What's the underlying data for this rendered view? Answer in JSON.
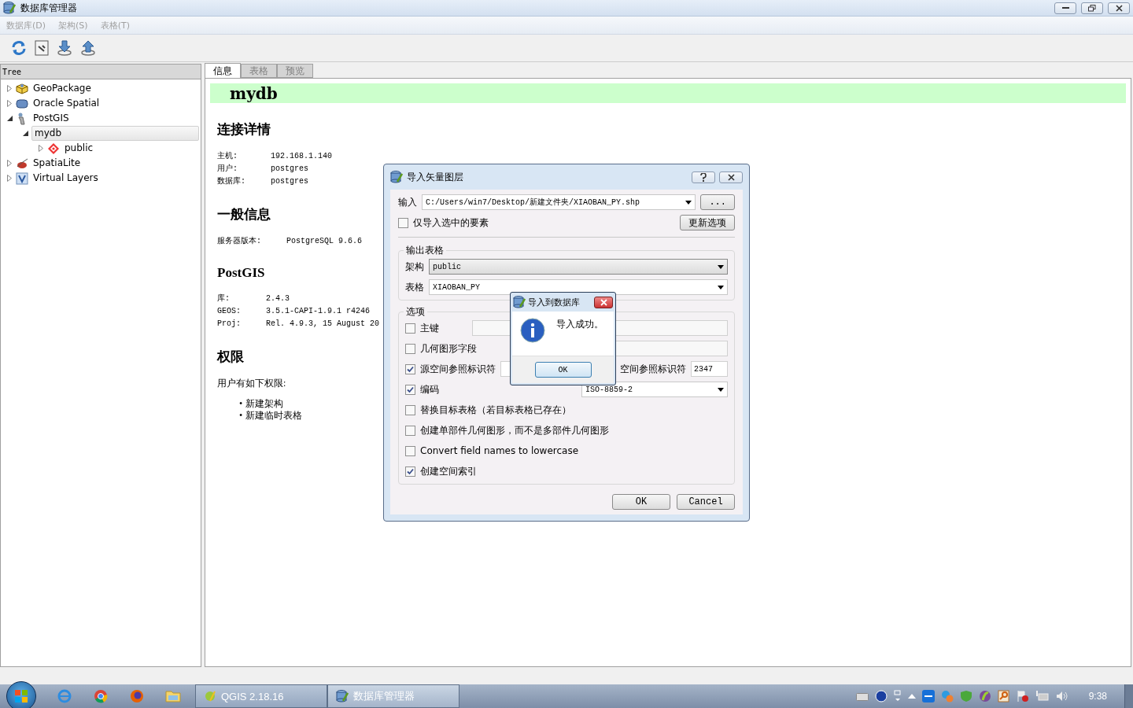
{
  "window": {
    "title": "数据库管理器"
  },
  "menu": [
    {
      "label": "数据库(D)",
      "disabled": true
    },
    {
      "label": "架构(S)",
      "disabled": true
    },
    {
      "label": "表格(T)",
      "disabled": true
    }
  ],
  "tree": {
    "header": "Tree",
    "items": [
      {
        "label": "GeoPackage",
        "kind": "geopackage",
        "expanded": false,
        "selected": false
      },
      {
        "label": "Oracle Spatial",
        "kind": "oracle",
        "expanded": false,
        "selected": false
      },
      {
        "label": "PostGIS",
        "kind": "postgis",
        "expanded": true,
        "selected": false,
        "children": [
          {
            "label": "mydb",
            "expanded": true,
            "selected": true,
            "children": [
              {
                "label": "public",
                "kind": "schema",
                "expanded": false,
                "selected": false
              }
            ]
          }
        ]
      },
      {
        "label": "SpatiaLite",
        "kind": "spatialite",
        "expanded": false,
        "selected": false
      },
      {
        "label": "Virtual Layers",
        "kind": "virtual",
        "expanded": false,
        "selected": false
      }
    ]
  },
  "tabs": [
    {
      "label": "信息",
      "selected": true
    },
    {
      "label": "表格",
      "selected": false
    },
    {
      "label": "预览",
      "selected": false
    }
  ],
  "info": {
    "title": "mydb",
    "sections": [
      {
        "kind": "table",
        "heading": "连接详情",
        "rows": [
          {
            "label": "主机:",
            "value": "192.168.1.140"
          },
          {
            "label": "用户:",
            "value": "postgres"
          },
          {
            "label": "数据库:",
            "value": "postgres"
          }
        ]
      },
      {
        "kind": "table",
        "heading": "一般信息",
        "rows": [
          {
            "label": "服务器版本:",
            "value": "PostgreSQL 9.6.6"
          }
        ]
      },
      {
        "kind": "table",
        "heading": "PostGIS",
        "rows": [
          {
            "label": "库:",
            "value": "2.4.3"
          },
          {
            "label": "GEOS:",
            "value": "3.5.1-CAPI-1.9.1 r4246"
          },
          {
            "label": "Proj:",
            "value": "Rel. 4.9.3, 15 August 20"
          }
        ]
      },
      {
        "kind": "list",
        "heading": "权限",
        "text": "用户有如下权限:",
        "bullet": "•",
        "items": [
          "新建架构",
          "新建临时表格"
        ]
      }
    ]
  },
  "import_dialog": {
    "title": "导入矢量图层",
    "input": {
      "label": "输入",
      "value": "C:/Users/win7/Desktop/新建文件夹/XIAOBAN_PY.shp",
      "browse": "..."
    },
    "only_selected": {
      "label": "仅导入选中的要素",
      "checked": false
    },
    "update_button": "更新选项",
    "output": {
      "title": "输出表格",
      "schema": {
        "label": "架构",
        "value": "public"
      },
      "table": {
        "label": "表格",
        "value": "XIAOBAN_PY"
      }
    },
    "options": {
      "title": "选项",
      "items": [
        {
          "kind": "field",
          "label": "主键",
          "checked": false
        },
        {
          "kind": "field",
          "label": "几何图形字段",
          "checked": false
        },
        {
          "kind": "srid",
          "label": "源空间参照标识符",
          "checked": true,
          "target_label": "空间参照标识符",
          "target_value": "2347"
        },
        {
          "kind": "select",
          "label": "编码",
          "checked": true,
          "value": "ISO-8859-2"
        },
        {
          "kind": "plain",
          "label": "替换目标表格（若目标表格已存在）",
          "checked": false
        },
        {
          "kind": "plain",
          "label": "创建单部件几何图形，而不是多部件几何图形",
          "checked": false
        },
        {
          "kind": "plain",
          "label": "Convert field names to lowercase",
          "checked": false
        },
        {
          "kind": "plain",
          "label": "创建空间索引",
          "checked": true
        }
      ]
    },
    "buttons": [
      "OK",
      "Cancel"
    ]
  },
  "message_box": {
    "title": "导入到数据库",
    "message": "导入成功。",
    "button": "OK"
  },
  "taskbar": {
    "tasks": [
      {
        "label": "QGIS 2.18.16",
        "selected": false
      },
      {
        "label": "数据库管理器",
        "selected": true
      }
    ],
    "clock": "9:38"
  }
}
